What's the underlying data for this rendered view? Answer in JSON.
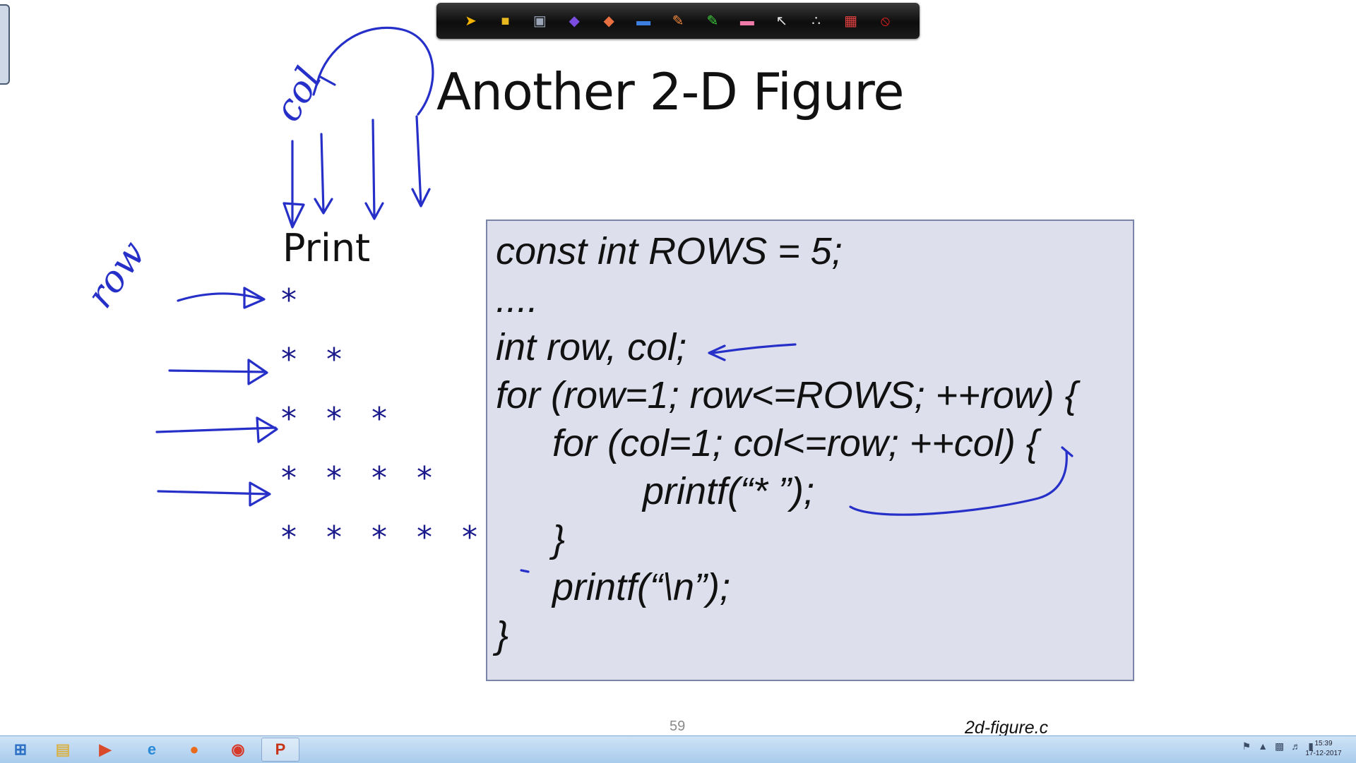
{
  "slide": {
    "title": "Another 2-D Figure",
    "print_label": "Print",
    "star_rows": [
      "*",
      "* *",
      "* * *",
      "* * * *",
      "* * * * *"
    ],
    "code_lines": [
      "const int ROWS = 5;",
      "....",
      "int row, col;",
      "for (row=1; row<=ROWS; ++row) {",
      "for (col=1; col<=row; ++col) {",
      "printf(“* ”);",
      "}",
      "printf(“\\n”);",
      "}"
    ],
    "page_number": "59",
    "file_name": "2d-figure.c"
  },
  "annotations": {
    "handwriting": [
      "row",
      "col"
    ],
    "ink_color": "#2630c8"
  },
  "annotation_toolbar": {
    "tools": [
      {
        "name": "arrow-tool-icon",
        "glyph": "➤",
        "color": "#f5b400"
      },
      {
        "name": "folder-icon",
        "glyph": "■",
        "color": "#e8b820"
      },
      {
        "name": "save-icon",
        "glyph": "▣",
        "color": "#9aa6b8"
      },
      {
        "name": "pen-tool-icon",
        "glyph": "◆",
        "color": "#7a4de0"
      },
      {
        "name": "marker-tool-icon",
        "glyph": "◆",
        "color": "#e87040"
      },
      {
        "name": "screen-icon",
        "glyph": "▬",
        "color": "#3d7fe0"
      },
      {
        "name": "pencil-icon",
        "glyph": "✎",
        "color": "#f08a3c"
      },
      {
        "name": "highlighter-icon",
        "glyph": "✎",
        "color": "#3ccc3c"
      },
      {
        "name": "eraser-icon",
        "glyph": "▬",
        "color": "#f07aa8"
      },
      {
        "name": "pointer-icon",
        "glyph": "↖",
        "color": "#e0e0e0"
      },
      {
        "name": "laser-dots-icon",
        "glyph": "∴",
        "color": "#e0e0e0"
      },
      {
        "name": "color-palette-icon",
        "glyph": "▦",
        "color": "#e04040"
      },
      {
        "name": "clear-stop-icon",
        "glyph": "⦸",
        "color": "#e02020"
      }
    ]
  },
  "taskbar": {
    "apps": [
      {
        "name": "start-button",
        "glyph": "⊞",
        "color": "#2a6fc4"
      },
      {
        "name": "file-explorer-icon",
        "glyph": "▤",
        "color": "#d8b24a"
      },
      {
        "name": "media-player-icon",
        "glyph": "▶",
        "color": "#d84a2a"
      },
      {
        "name": "internet-explorer-icon",
        "glyph": "e",
        "color": "#2a8ad8"
      },
      {
        "name": "firefox-icon",
        "glyph": "●",
        "color": "#e86a1a"
      },
      {
        "name": "chrome-icon",
        "glyph": "◉",
        "color": "#d83a2a"
      },
      {
        "name": "powerpoint-icon",
        "glyph": "P",
        "color": "#c8341a"
      }
    ],
    "clock_time": "15:39",
    "clock_date": "17-12-2017"
  }
}
